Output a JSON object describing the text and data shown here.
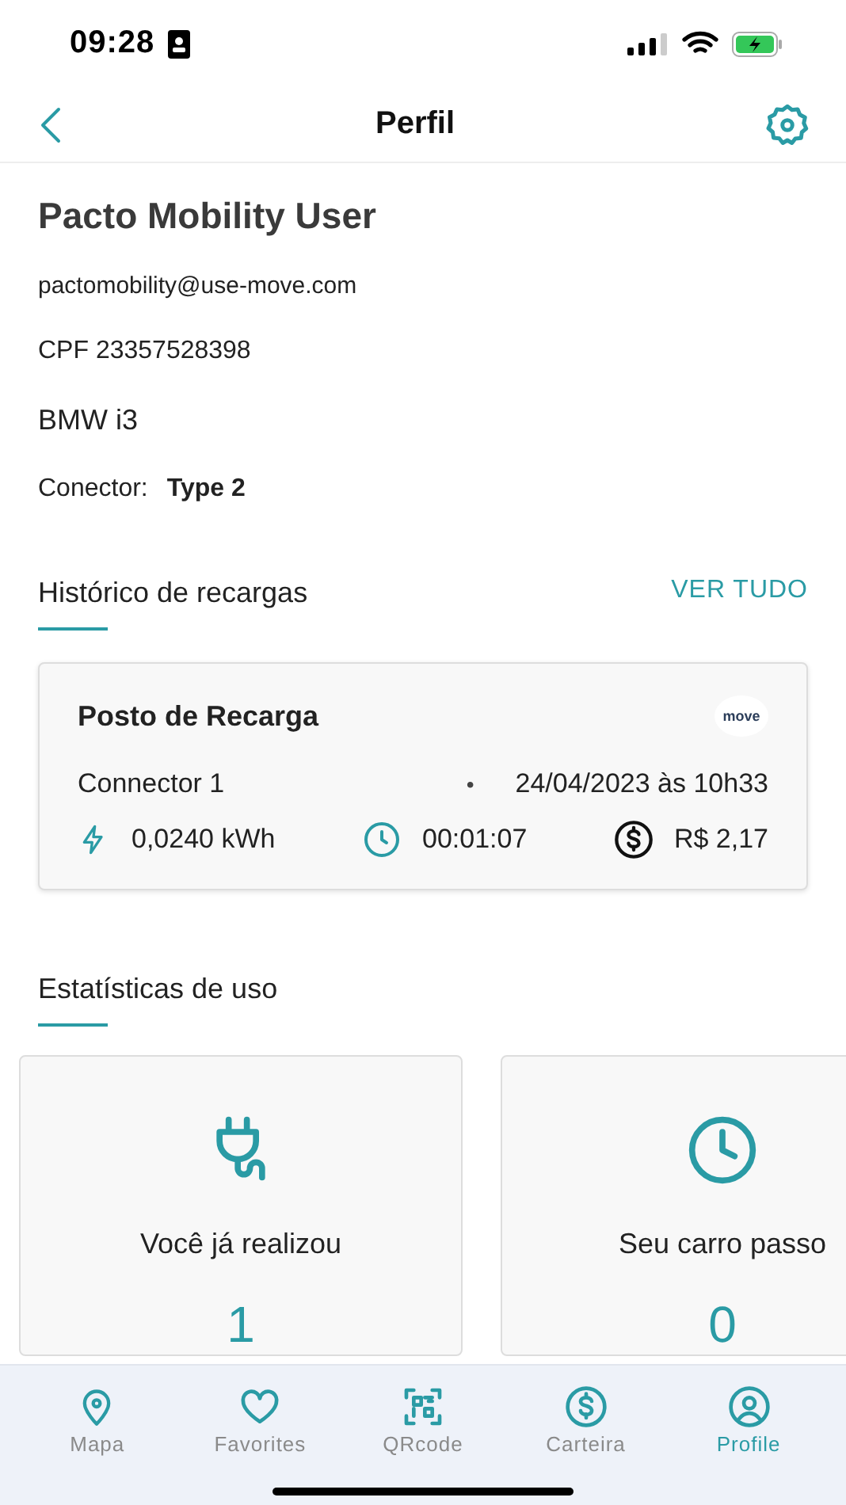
{
  "status_bar": {
    "time": "09:28"
  },
  "header": {
    "title": "Perfil"
  },
  "profile": {
    "name": "Pacto Mobility User",
    "email": "pactomobility@use-move.com",
    "cpf": "CPF 23357528398",
    "car": "BMW i3",
    "connector_label": "Conector:",
    "connector_value": "Type 2"
  },
  "history": {
    "title": "Histórico de recargas",
    "link": "VER TUDO",
    "card": {
      "station": "Posto de Recarga",
      "logo": "move",
      "connector": "Connector 1",
      "separator": "•",
      "datetime": "24/04/2023 às 10h33",
      "energy": "0,0240 kWh",
      "duration": "00:01:07",
      "cost": "R$ 2,17"
    }
  },
  "stats": {
    "title": "Estatísticas de uso",
    "cards": [
      {
        "kind": "plug",
        "label": "Você já realizou",
        "value": "1"
      },
      {
        "kind": "clock",
        "label": "Seu carro passo",
        "value": "0"
      }
    ]
  },
  "tab_bar": [
    {
      "kind": "map",
      "label": "Mapa",
      "selected": false
    },
    {
      "kind": "heart",
      "label": "Favorites",
      "selected": false
    },
    {
      "kind": "qr",
      "label": "QRcode",
      "selected": false
    },
    {
      "kind": "wallet",
      "label": "Carteira",
      "selected": false
    },
    {
      "kind": "profile",
      "label": "Profile",
      "selected": true
    }
  ]
}
